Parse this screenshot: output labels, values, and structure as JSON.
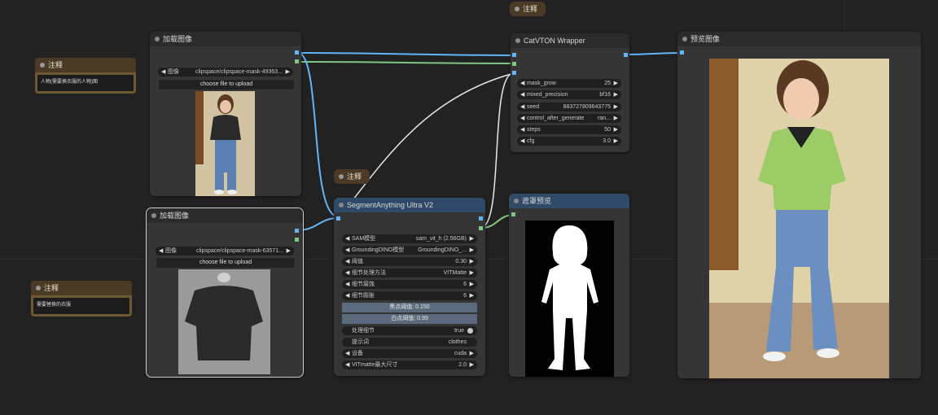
{
  "colors": {
    "canvas": "#222222",
    "image_wire": "#64b5f6",
    "mask_wire": "#81c784",
    "generic_wire": "#ffffff",
    "segment_header": "#2f4a66",
    "note_header": "#4a3a26",
    "note_border": "#6d5a32"
  },
  "notes": {
    "top_center": {
      "title": "注释"
    },
    "left_top": {
      "title": "注释",
      "text": "人物(需要换衣服的人物)图"
    },
    "mid": {
      "title": "注释"
    },
    "left_bottom": {
      "title": "注释",
      "text": "需要替换的衣服"
    }
  },
  "load_image_1": {
    "title": "加载图像",
    "image_label": "图像",
    "image_value": "clipspace/clipspace-mask-4...",
    "image_value_full": "clipspace/clipspace-mask-49363...",
    "upload_label": "choose file to upload"
  },
  "load_image_2": {
    "title": "加载图像",
    "image_label": "图像",
    "image_value": "clipspace/clipspace-mask-63571...",
    "upload_label": "choose file to upload"
  },
  "catvton": {
    "title": "CatVTON Wrapper",
    "widgets": [
      {
        "label": "mask_grow",
        "value": "25"
      },
      {
        "label": "mixed_precision",
        "value": "bf16"
      },
      {
        "label": "seed",
        "value": "883727809643775"
      },
      {
        "label": "control_after_generate",
        "value": "ran..."
      },
      {
        "label": "steps",
        "value": "50"
      },
      {
        "label": "cfg",
        "value": "3.0"
      }
    ]
  },
  "segment": {
    "title": "SegmentAnything Ultra V2",
    "widgets": [
      {
        "label": "SAM模型",
        "value": "sam_vit_h (2.56GB)"
      },
      {
        "label": "GroundingDINO模型",
        "value": "GroundingDINO_..."
      },
      {
        "label": "阈值",
        "value": "0.30"
      },
      {
        "label": "细节处理方法",
        "value": "VITMatte"
      },
      {
        "label": "细节腐蚀",
        "value": "6"
      },
      {
        "label": "细节膨胀",
        "value": "6"
      }
    ],
    "black_point": "黑点阈值: 0.150",
    "white_point": "白点阈值: 0.99",
    "process_detail_label": "处理细节",
    "process_detail_value": "true",
    "prompt_label": "提示词",
    "prompt_value": "clothes",
    "device_label": "设备",
    "device_value": "cuda",
    "max_megapixels_label": "VITmatte最大尺寸",
    "max_megapixels_value": "2.0"
  },
  "mask_preview": {
    "title": "遮罩预览"
  },
  "preview_image": {
    "title": "预览图像"
  }
}
